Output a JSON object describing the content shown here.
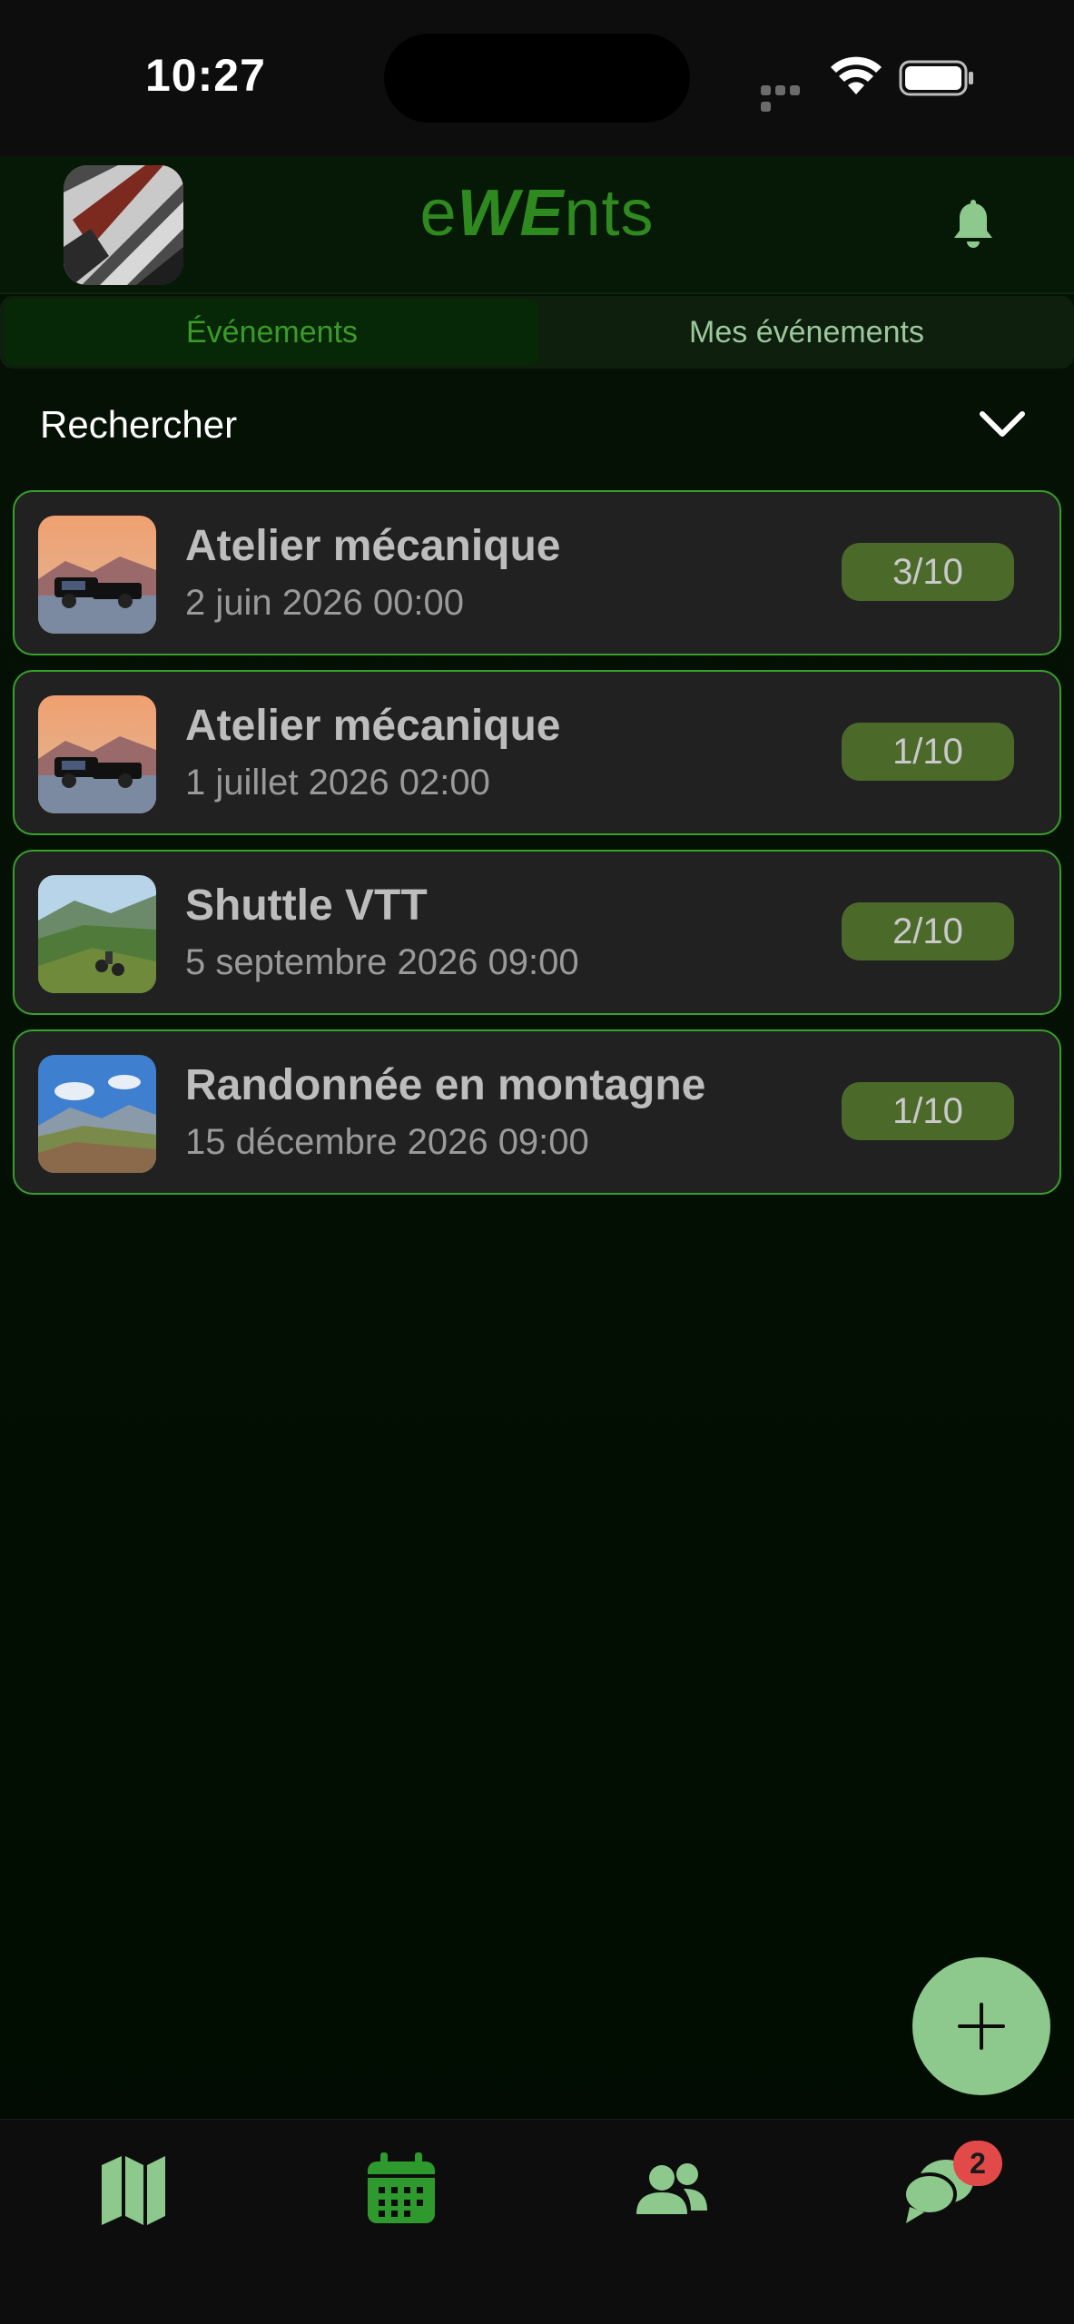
{
  "status_bar": {
    "time": "10:27"
  },
  "header": {
    "title_prefix": "e",
    "title_highlight": "WE",
    "title_suffix": "nts",
    "avatar_icon": "profile-avatar",
    "notification_icon": "bell-icon"
  },
  "tabs": [
    {
      "label": "Événements",
      "active": true
    },
    {
      "label": "Mes événements",
      "active": false
    }
  ],
  "search": {
    "label": "Rechercher",
    "toggle_icon": "chevron-down-icon"
  },
  "events": [
    {
      "title": "Atelier mécanique",
      "date": "2 juin 2026 00:00",
      "count": "3/10",
      "image": "pickup-truck-sunset"
    },
    {
      "title": "Atelier mécanique",
      "date": "1 juillet 2026 02:00",
      "count": "1/10",
      "image": "pickup-truck-sunset"
    },
    {
      "title": "Shuttle VTT",
      "date": "5 septembre 2026 09:00",
      "count": "2/10",
      "image": "mountain-bike-trail"
    },
    {
      "title": "Randonnée en montagne",
      "date": "15 décembre 2026 09:00",
      "count": "1/10",
      "image": "mountain-landscape"
    }
  ],
  "fab": {
    "icon": "plus-icon"
  },
  "bottom_nav": {
    "items": [
      {
        "icon": "map-icon",
        "active": false
      },
      {
        "icon": "calendar-icon",
        "active": true
      },
      {
        "icon": "users-icon",
        "active": false
      },
      {
        "icon": "chat-icon",
        "active": false
      }
    ],
    "chat_badge": "2"
  },
  "colors": {
    "accent": "#37a12a",
    "title": "#2e8a1e",
    "badge_bg": "#4b6a2a",
    "fab": "#8dc98d",
    "nav_icon": "#8dc98d",
    "nav_active": "#2e9a2e",
    "notification_badge": "#e24a4a"
  }
}
